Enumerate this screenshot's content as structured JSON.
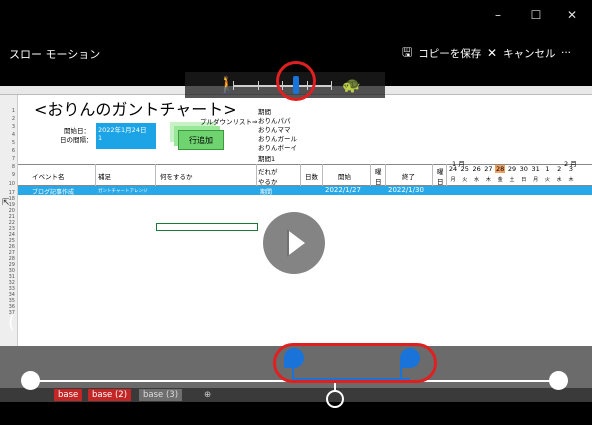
{
  "window": {
    "minimize_icon": "minimize-icon",
    "maximize_icon": "maximize-icon",
    "close_icon": "close-icon",
    "minimize_glyph": "–",
    "maximize_glyph": "☐",
    "close_glyph": "✕"
  },
  "command_bar": {
    "title": "スロー モーション",
    "save_copy_label": "コピーを保存",
    "cancel_label": "キャンセル",
    "more_glyph": "···",
    "save_icon": "save-icon",
    "cancel_icon": "close-icon"
  },
  "speed_control": {
    "walk_icon": "walker-icon",
    "turtle_icon": "turtle-icon",
    "selected_level": 4,
    "level_count": 5
  },
  "spreadsheet": {
    "title": "<おりんのガントチャート>",
    "start_label": "開始日：",
    "start_value": "2022年1月24日",
    "days_label": "日の間隔：",
    "days_value": "1",
    "dropdown_label": "プルダウンリスト⇒",
    "dropdown_items": [
      "期間",
      "おりんパパ",
      "おりんママ",
      "おりんガール",
      "おりんボーイ",
      "期間1"
    ],
    "add_row_button": "行追加",
    "headers": {
      "event": "イベント名",
      "detail": "補足",
      "what": "何をするか",
      "who": "だれが やるか",
      "days": "日数",
      "start": "開始",
      "dow": "曜日",
      "end": "終了",
      "dow2": "曜日"
    },
    "months": [
      "1 月",
      "2 月"
    ],
    "dates": [
      "24",
      "25",
      "26",
      "27",
      "28",
      "29",
      "30",
      "31",
      "1",
      "2",
      "3"
    ],
    "weekdays": [
      "月",
      "火",
      "水",
      "木",
      "金",
      "土",
      "日",
      "月",
      "火",
      "水",
      "木"
    ],
    "highlight_date": "28",
    "row": {
      "event": "ブログ記事作成",
      "detail": "ガントチャートアレンジ",
      "who": "期間",
      "start": "2022/1/27",
      "end": "2022/1/30"
    },
    "row_numbers": [
      "1",
      "2",
      "3",
      "4",
      "5",
      "6",
      "7",
      "8",
      "9",
      "10",
      "17",
      "18",
      "19",
      "20",
      "21",
      "22",
      "23",
      "24",
      "25",
      "26",
      "27",
      "28",
      "29",
      "30",
      "31",
      "32",
      "33",
      "34",
      "35",
      "36",
      "37"
    ],
    "sheet_tabs": [
      "base",
      "base (2)",
      "base (3)"
    ],
    "add_sheet_glyph": "⊕"
  },
  "player": {
    "play_icon": "play-icon"
  },
  "colors": {
    "accent": "#1a73d9",
    "annotation": "#e02020",
    "excel_blue": "#29a8e8"
  }
}
